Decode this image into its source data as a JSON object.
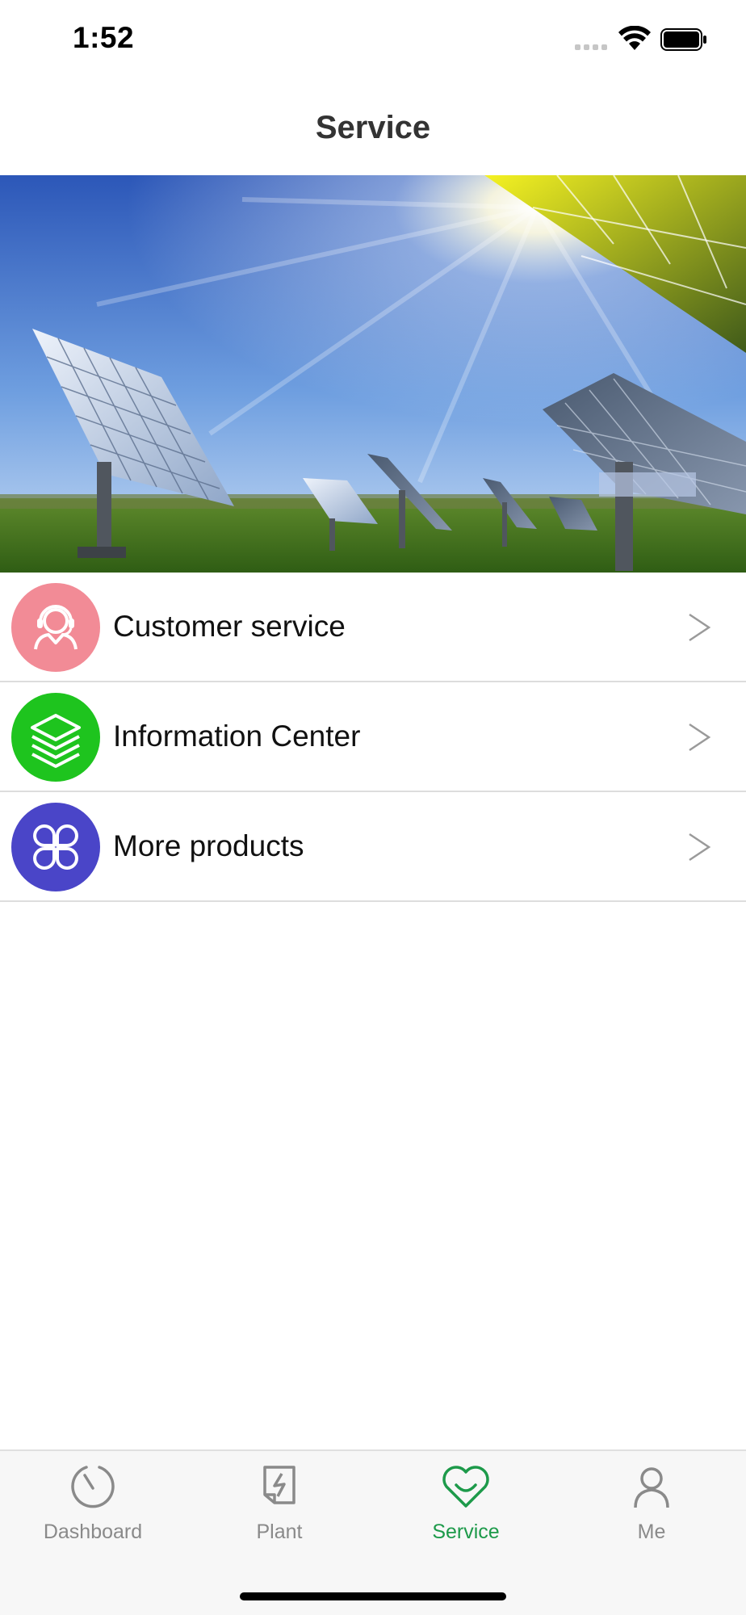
{
  "status_bar": {
    "time": "1:52",
    "icons": [
      "cellular-signal-icon",
      "wifi-icon",
      "battery-icon"
    ]
  },
  "nav": {
    "title": "Service"
  },
  "banner": {
    "pages": 2,
    "active_page": 2
  },
  "menu": {
    "items": [
      {
        "label": "Customer service",
        "icon": "customer-service-icon",
        "color": "#f28b96"
      },
      {
        "label": "Information Center",
        "icon": "layers-icon",
        "color": "#1ec41e"
      },
      {
        "label": "More products",
        "icon": "four-leaf-grid-icon",
        "color": "#4a45c8"
      }
    ]
  },
  "tab_bar": {
    "tabs": [
      {
        "label": "Dashboard",
        "icon": "gauge-icon",
        "active": false
      },
      {
        "label": "Plant",
        "icon": "plant-bolt-icon",
        "active": false
      },
      {
        "label": "Service",
        "icon": "heart-smile-icon",
        "active": true
      },
      {
        "label": "Me",
        "icon": "person-icon",
        "active": false
      }
    ],
    "active_color": "#1d9a4a",
    "inactive_color": "#8a8a8a"
  }
}
